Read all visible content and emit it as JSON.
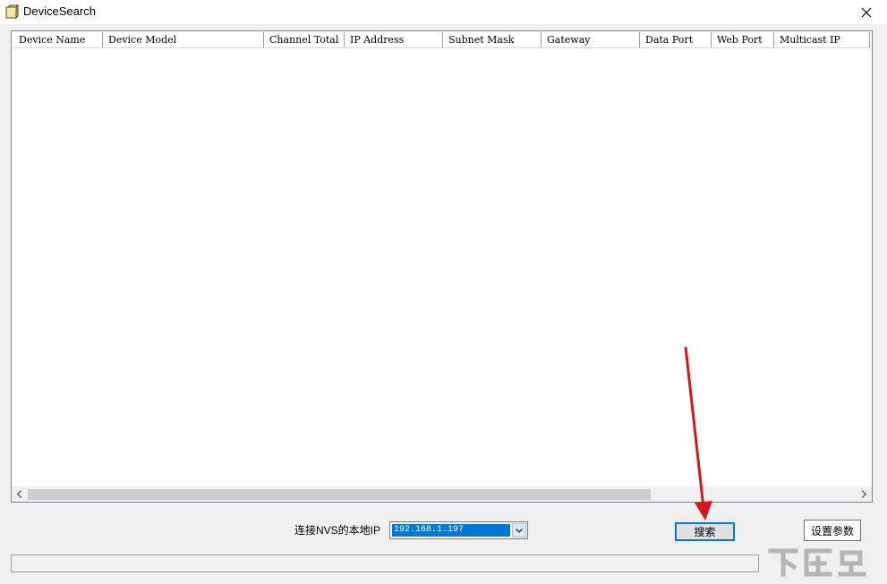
{
  "window": {
    "title": "DeviceSearch",
    "close_icon": "close-icon",
    "app_icon": "notebook-icon"
  },
  "table": {
    "columns": [
      "Device Name",
      "Device Model",
      "Channel Total",
      "IP Address",
      "Subnet Mask",
      "Gateway",
      "Data Port",
      "Web Port",
      "Multicast IP"
    ],
    "rows": []
  },
  "controls": {
    "ip_label": "连接NVS的本地IP",
    "ip_value": "192.168.1.197",
    "search_label": "搜索",
    "settings_label": "设置参数"
  },
  "colors": {
    "selection": "#0078d7",
    "annotation_arrow": "#d01818"
  },
  "watermark": "下载吧"
}
